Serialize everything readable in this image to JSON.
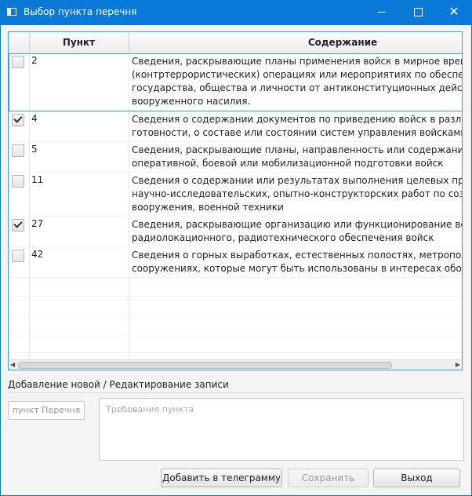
{
  "window": {
    "title": "Выбор пункта перечня",
    "minimize": "",
    "maximize": "",
    "close": "✕"
  },
  "table": {
    "columns": [
      "",
      "Пункт",
      "Содержание"
    ],
    "rows": [
      {
        "checked": false,
        "selected": true,
        "num": "2",
        "lines": [
          "Сведения, раскрывающие планы применения войск в мирное время в спец",
          "(контртеррористических) операциях или мероприятиях по обеспечению за",
          "государства, общества и личности от антиконституционных действий и прот",
          "вооруженного насилия."
        ]
      },
      {
        "checked": true,
        "selected": false,
        "num": "4",
        "lines": [
          "Сведения о содержании документов по приведению войск в различные сте",
          "готовности, о составе или состоянии систем управления войсками"
        ]
      },
      {
        "checked": false,
        "selected": false,
        "num": "5",
        "lines": [
          "Сведения, раскрывающие планы, направленность или содержание меропри",
          "оперативной, боевой или мобилизационной подготовки войск"
        ]
      },
      {
        "checked": false,
        "selected": false,
        "num": "11",
        "lines": [
          "Сведения о содержании или результатах выполнения целевых программ,",
          "научно-исследовательских, опытно-конструкторских работ по созданию или",
          "вооружения, военной техники"
        ]
      },
      {
        "checked": true,
        "selected": false,
        "num": "27",
        "lines": [
          "Сведения, раскрывающие организацию или функционирование всех видов",
          "радиолокационного, радиотехнического обеспечения войск"
        ]
      },
      {
        "checked": false,
        "selected": false,
        "num": "42",
        "lines": [
          "Сведения о горных выработках, естественных полостях, метрополитенах или",
          "сооружениях, которые могут быть использованы в интересах обороны стра"
        ]
      }
    ],
    "empty_rows": 5
  },
  "form": {
    "section_title": "Добавление новой / Редактирование записи",
    "punkt_placeholder": "пункт Перечня",
    "requirements_placeholder": "Требования пункта"
  },
  "buttons": {
    "add": "Добавить в телеграмму",
    "save": "Сохранить",
    "exit": "Выход"
  }
}
